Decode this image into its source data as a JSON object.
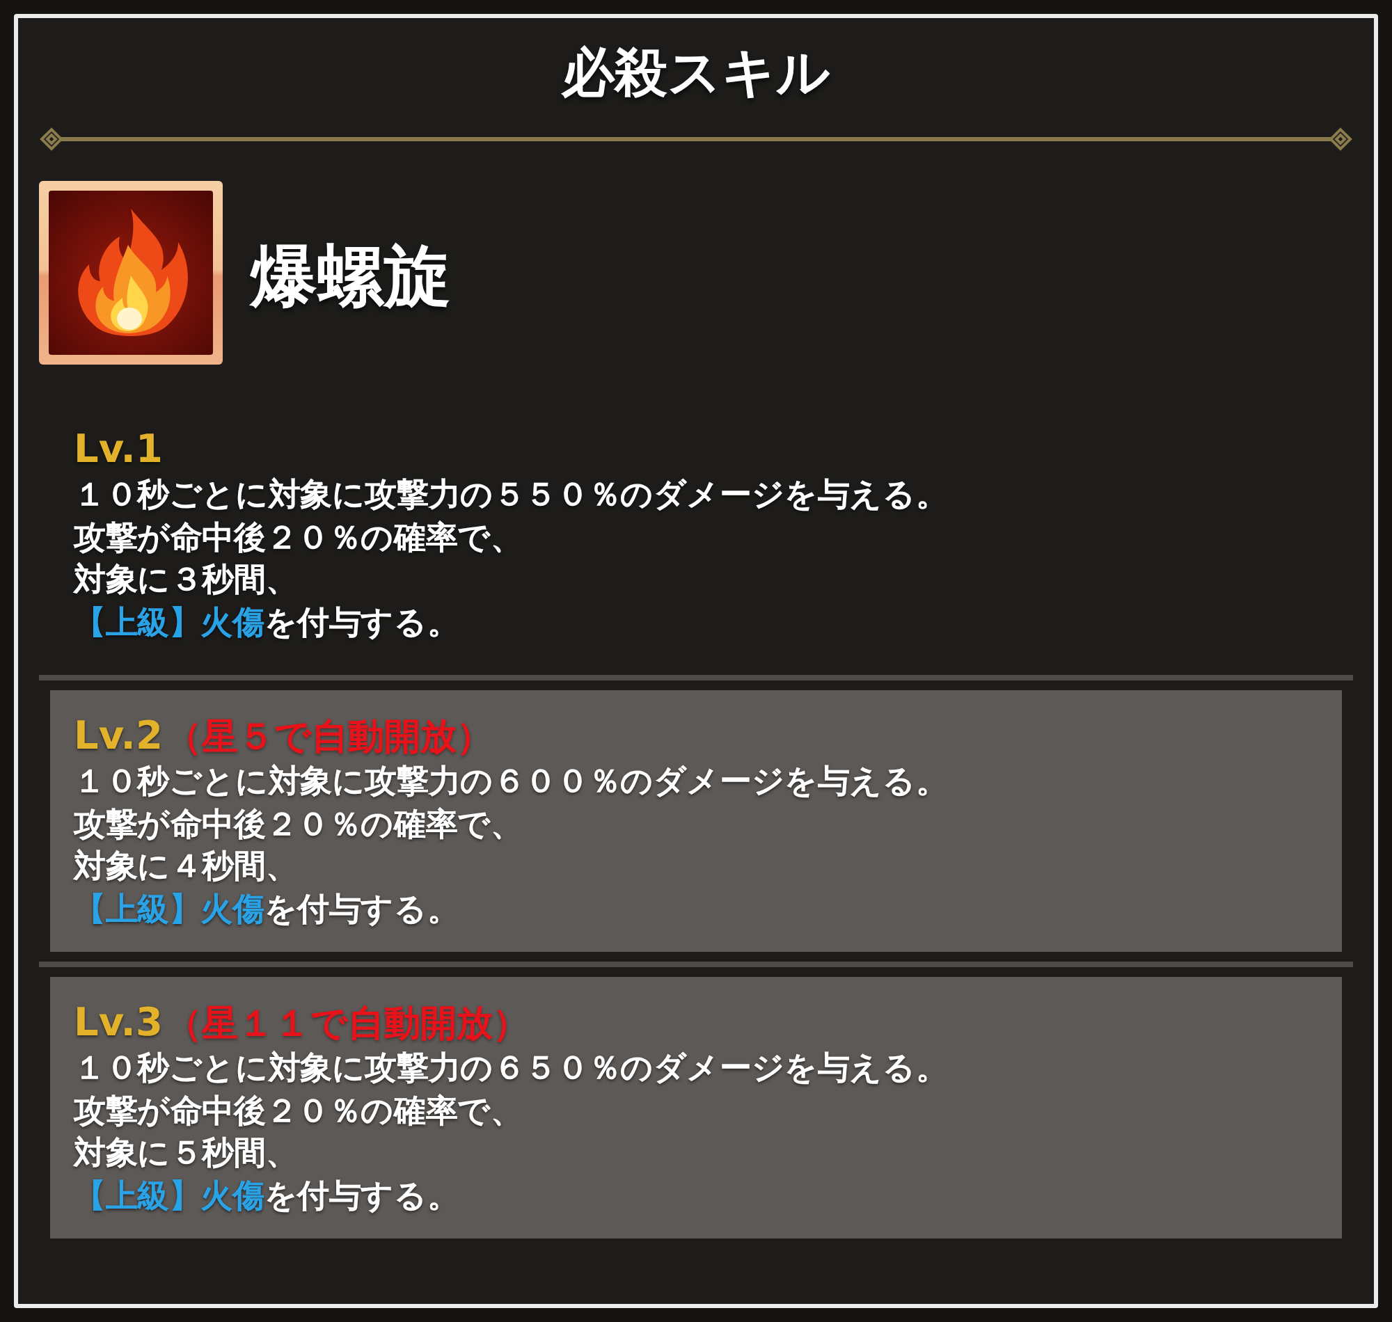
{
  "title": "必殺スキル",
  "skill": {
    "name": "爆螺旋"
  },
  "levels": [
    {
      "label": "Lv.1",
      "locked": false,
      "lines": [
        [
          {
            "text": "１０秒ごとに対象に攻撃力の５５０％のダメージを与える。",
            "highlight": false
          }
        ],
        [
          {
            "text": "攻撃が命中後２０％の確率で、",
            "highlight": false
          }
        ],
        [
          {
            "text": "対象に３秒間、",
            "highlight": false
          }
        ],
        [
          {
            "text": "【上級】火傷",
            "highlight": true
          },
          {
            "text": "を付与する。",
            "highlight": false
          }
        ]
      ]
    },
    {
      "label": "Lv.2",
      "condition": "（星５で自動開放）",
      "locked": true,
      "lines": [
        [
          {
            "text": "１０秒ごとに対象に攻撃力の６００％のダメージを与える。",
            "highlight": false
          }
        ],
        [
          {
            "text": "攻撃が命中後２０％の確率で、",
            "highlight": false
          }
        ],
        [
          {
            "text": "対象に４秒間、",
            "highlight": false
          }
        ],
        [
          {
            "text": "【上級】火傷",
            "highlight": true
          },
          {
            "text": "を付与する。",
            "highlight": false
          }
        ]
      ]
    },
    {
      "label": "Lv.3",
      "condition": "（星１１で自動開放）",
      "locked": true,
      "lines": [
        [
          {
            "text": "１０秒ごとに対象に攻撃力の６５０％のダメージを与える。",
            "highlight": false
          }
        ],
        [
          {
            "text": "攻撃が命中後２０％の確率で、",
            "highlight": false
          }
        ],
        [
          {
            "text": "対象に５秒間、",
            "highlight": false
          }
        ],
        [
          {
            "text": "【上級】火傷",
            "highlight": true
          },
          {
            "text": "を付与する。",
            "highlight": false
          }
        ]
      ]
    }
  ]
}
